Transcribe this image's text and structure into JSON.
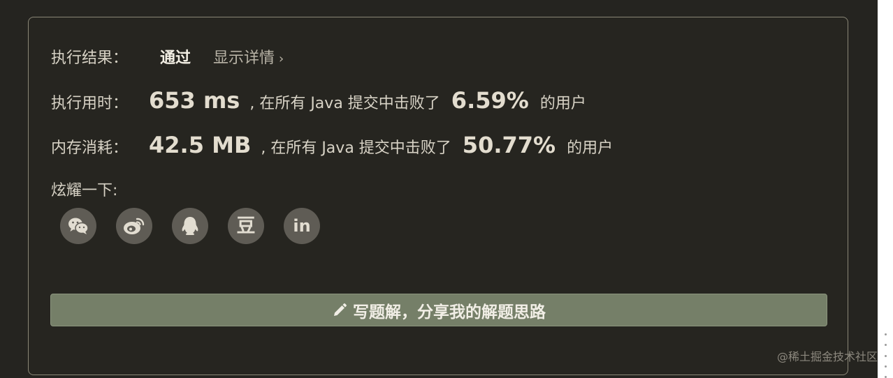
{
  "result": {
    "label": "执行结果：",
    "status": "通过",
    "detail_link": "显示详情",
    "detail_chevron": "›"
  },
  "runtime": {
    "label": "执行用时：",
    "value": "653 ms",
    "middle": ", 在所有 Java 提交中击败了",
    "percent": "6.59%",
    "tail": "的用户"
  },
  "memory": {
    "label": "内存消耗：",
    "value": "42.5 MB",
    "middle": ", 在所有 Java 提交中击败了",
    "percent": "50.77%",
    "tail": "的用户"
  },
  "share": {
    "label": "炫耀一下:",
    "douban_glyph": "豆",
    "linkedin_glyph": "in",
    "icons": [
      "wechat-icon",
      "weibo-icon",
      "qq-icon",
      "douban-icon",
      "linkedin-icon"
    ]
  },
  "write_button": {
    "label": "写题解，分享我的解题思路",
    "icon": "pencil-icon"
  },
  "watermark": "@稀土掘金技术社区",
  "colors": {
    "background": "#252420",
    "border": "#8a8777",
    "button": "#757f68",
    "share_circle": "#5f5c55"
  }
}
